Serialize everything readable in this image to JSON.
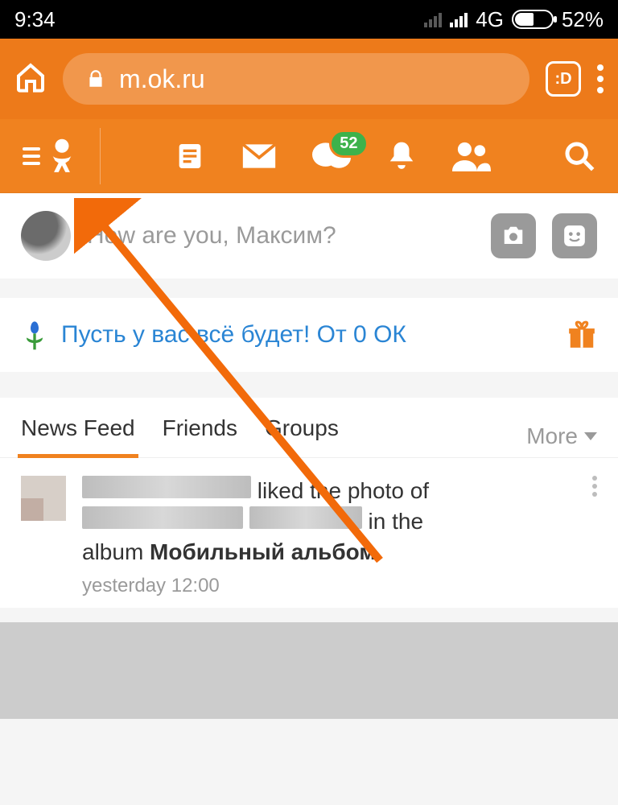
{
  "status": {
    "time": "9:34",
    "network": "4G",
    "battery_percent": "52%"
  },
  "browser": {
    "url": "m.ok.ru",
    "tab_label": ":D"
  },
  "nav": {
    "messages_badge": "52"
  },
  "compose": {
    "placeholder": "How are you, Максим?"
  },
  "promo": {
    "text": "Пусть у вас всё будет! От 0 ОК"
  },
  "tabs": {
    "items": [
      "News Feed",
      "Friends",
      "Groups"
    ],
    "more": "More"
  },
  "feed": {
    "item0": {
      "liked_text": " liked the photo of ",
      "in_the": " in the ",
      "album_word": "album ",
      "album_name": "Мобильный альбом",
      "timestamp": "yesterday 12:00"
    }
  }
}
